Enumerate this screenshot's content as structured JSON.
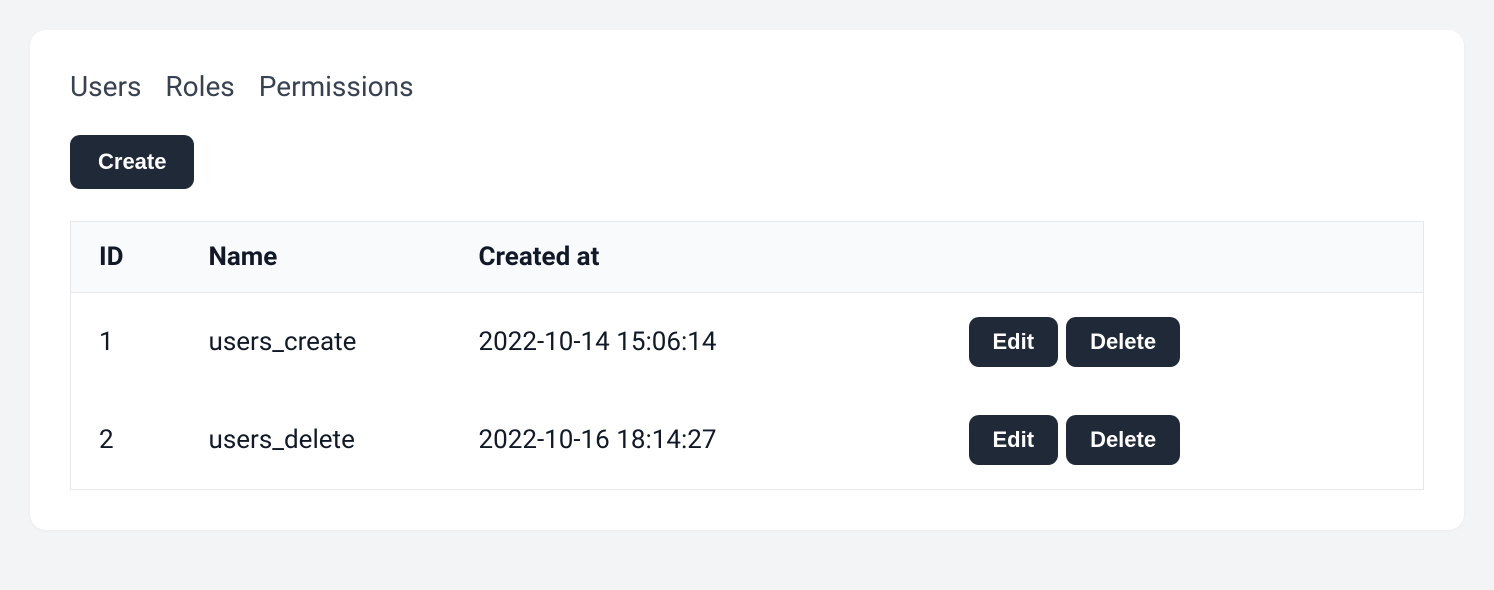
{
  "tabs": {
    "users": "Users",
    "roles": "Roles",
    "permissions": "Permissions"
  },
  "actions": {
    "create": "Create",
    "edit": "Edit",
    "delete": "Delete"
  },
  "table": {
    "headers": {
      "id": "ID",
      "name": "Name",
      "created_at": "Created at"
    },
    "rows": [
      {
        "id": "1",
        "name": "users_create",
        "created_at": "2022-10-14 15:06:14"
      },
      {
        "id": "2",
        "name": "users_delete",
        "created_at": "2022-10-16 18:14:27"
      }
    ]
  }
}
